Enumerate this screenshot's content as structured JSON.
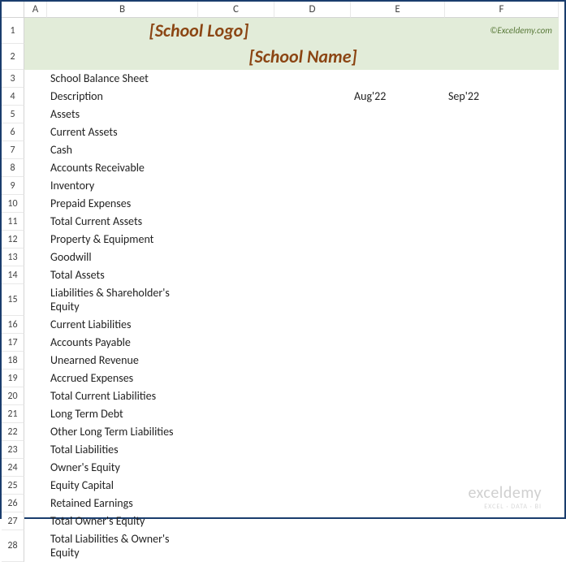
{
  "columns": [
    "",
    "A",
    "B",
    "C",
    "D",
    "E",
    "F"
  ],
  "header": {
    "logo": "[School Logo]",
    "name": "[School Name]",
    "credit": "©Exceldemy.com"
  },
  "rows": [
    {
      "n": "3",
      "b": "School Balance Sheet"
    },
    {
      "n": "4",
      "b": "Description",
      "e": "Aug'22",
      "f": "Sep'22"
    },
    {
      "n": "5",
      "b": "Assets"
    },
    {
      "n": "6",
      "b": "Current Assets"
    },
    {
      "n": "7",
      "b": "Cash"
    },
    {
      "n": "8",
      "b": "Accounts Receivable"
    },
    {
      "n": "9",
      "b": "Inventory"
    },
    {
      "n": "10",
      "b": "Prepaid Expenses"
    },
    {
      "n": "11",
      "b": "Total Current Assets"
    },
    {
      "n": "12",
      "b": "Property & Equipment"
    },
    {
      "n": "13",
      "b": "Goodwill"
    },
    {
      "n": "14",
      "b": "Total Assets"
    },
    {
      "n": "15",
      "b": "Liabilities & Shareholder's Equity"
    },
    {
      "n": "16",
      "b": "Current Liabilities"
    },
    {
      "n": "17",
      "b": "Accounts Payable"
    },
    {
      "n": "18",
      "b": "Unearned Revenue"
    },
    {
      "n": "19",
      "b": "Accrued Expenses"
    },
    {
      "n": "20",
      "b": "Total Current Liabilities"
    },
    {
      "n": "21",
      "b": "Long Term Debt"
    },
    {
      "n": "22",
      "b": "Other Long Term Liabilities"
    },
    {
      "n": "23",
      "b": "Total Liabilities"
    },
    {
      "n": "24",
      "b": "Owner's Equity"
    },
    {
      "n": "25",
      "b": "Equity Capital"
    },
    {
      "n": "26",
      "b": "Retained Earnings"
    },
    {
      "n": "27",
      "b": "Total Owner's Equity"
    },
    {
      "n": "28",
      "b": "Total Liabilities & Owner's Equity"
    }
  ],
  "watermark": {
    "main": "exceldemy",
    "sub": "EXCEL · DATA · BI"
  }
}
